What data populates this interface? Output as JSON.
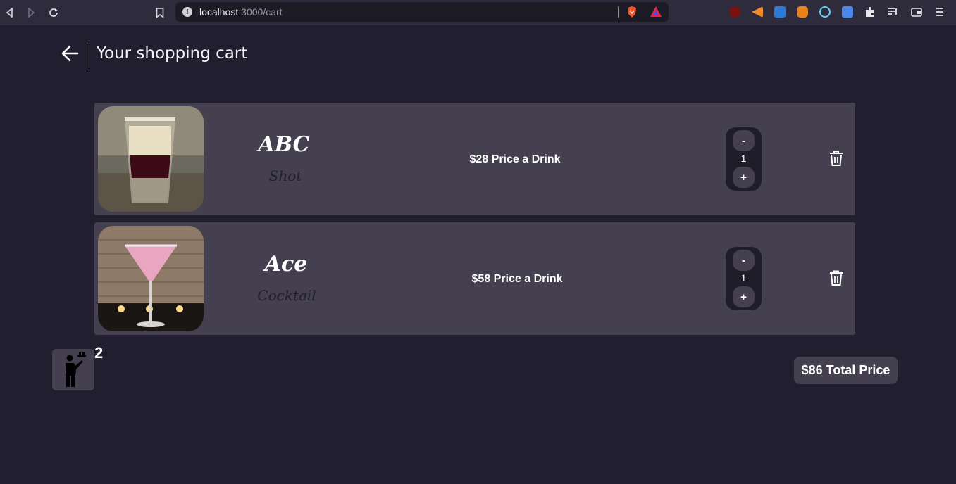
{
  "browser": {
    "url_host": "localhost",
    "url_path": ":3000/cart"
  },
  "header": {
    "title": "Your shopping cart"
  },
  "cart": {
    "items": [
      {
        "name": "ABC",
        "type": "Shot",
        "price_text": "$28 Price a Drink",
        "quantity": "1",
        "decrement_label": "-",
        "increment_label": "+"
      },
      {
        "name": "Ace",
        "type": "Cocktail",
        "price_text": "$58 Price a Drink",
        "quantity": "1",
        "decrement_label": "-",
        "increment_label": "+"
      }
    ]
  },
  "footer": {
    "waiter_count": "2",
    "total_text": "$86 Total Price"
  },
  "colors": {
    "background": "#211f2f",
    "card": "#44404f",
    "stepper": "#1f1d2a"
  },
  "icons": [
    "back-arrow-icon",
    "trash-icon",
    "waiter-icon",
    "info-icon",
    "bookmark-icon"
  ]
}
